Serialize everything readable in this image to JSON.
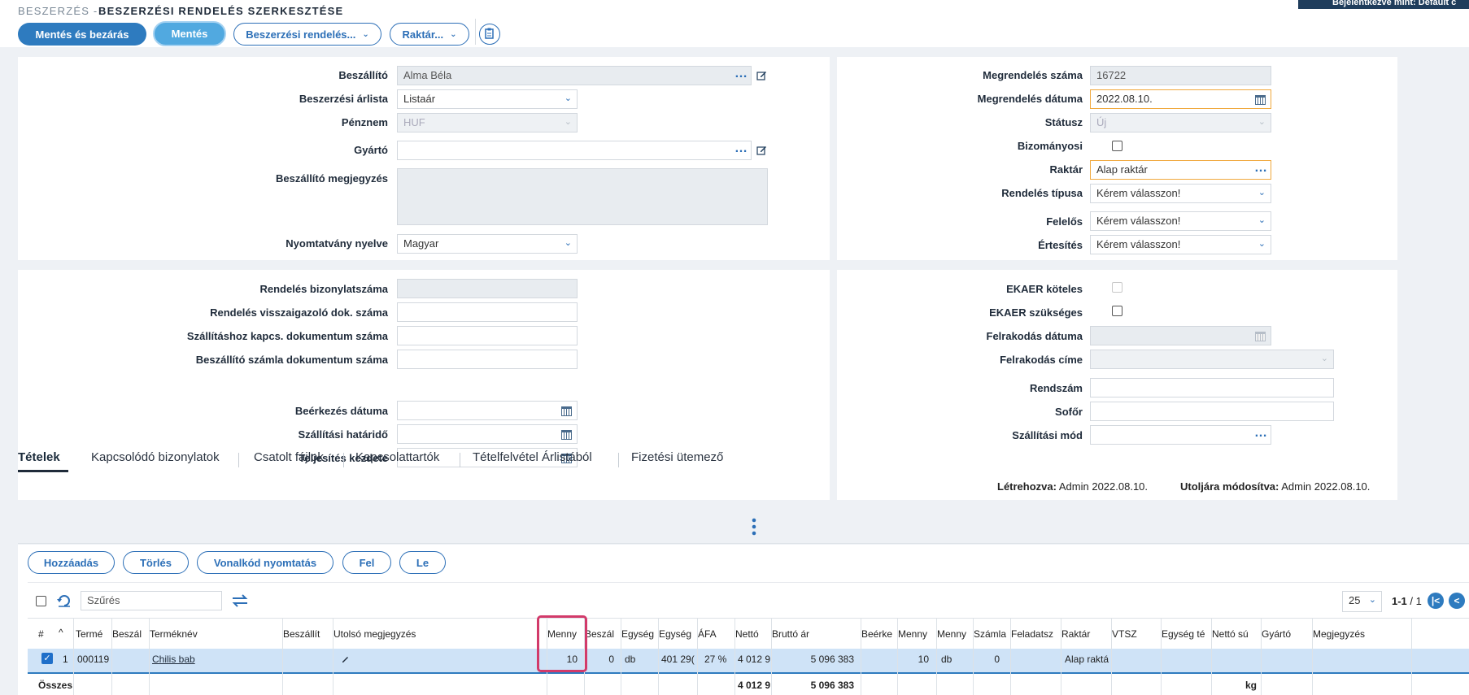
{
  "header": {
    "crumb": "BESZERZÉS -",
    "title": "BESZERZÉSI RENDELÉS SZERKESZTÉSE",
    "login": "Bejelentkezve mint: Default c"
  },
  "toolbar": {
    "save_close": "Mentés és bezárás",
    "save": "Mentés",
    "order_menu": "Beszerzési rendelés...",
    "warehouse_menu": "Raktár..."
  },
  "form1": {
    "supplier_label": "Beszállító",
    "supplier_value": "Alma Béla",
    "pricelist_label": "Beszerzési árlista",
    "pricelist_value": "Listaár",
    "currency_label": "Pénznem",
    "currency_value": "HUF",
    "manufacturer_label": "Gyártó",
    "manufacturer_value": "",
    "note_label": "Beszállító megjegyzés",
    "printlang_label": "Nyomtatvány nyelve",
    "printlang_value": "Magyar"
  },
  "form2": {
    "ordernum_label": "Megrendelés száma",
    "ordernum_value": "16722",
    "orderdate_label": "Megrendelés dátuma",
    "orderdate_value": "2022.08.10.",
    "status_label": "Státusz",
    "status_value": "Új",
    "consign_label": "Bizományosi",
    "warehouse_label": "Raktár",
    "warehouse_value": "Alap raktár",
    "ordertype_label": "Rendelés típusa",
    "ordertype_value": "Kérem válasszon!",
    "responsible_label": "Felelős",
    "responsible_value": "Kérem válasszon!",
    "notify_label": "Értesítés",
    "notify_value": "Kérem válasszon!"
  },
  "form3": {
    "docnum_label": "Rendelés bizonylatszáma",
    "confirm_label": "Rendelés visszaigazoló dok. száma",
    "shipdoc_label": "Szállításhoz kapcs. dokumentum száma",
    "invoice_label": "Beszállító számla dokumentum száma",
    "arrival_label": "Beérkezés dátuma",
    "deadline_label": "Szállítási határidő",
    "fulfil_label": "Teljesítés kezdete"
  },
  "form4": {
    "ekaer_req_label": "EKAER köteles",
    "ekaer_need_label": "EKAER szükséges",
    "loaddate_label": "Felrakodás dátuma",
    "loadaddr_label": "Felrakodás címe",
    "plate_label": "Rendszám",
    "driver_label": "Sofőr",
    "shipmode_label": "Szállítási mód",
    "created_label": "Létrehozva:",
    "created_value": "Admin 2022.08.10.",
    "modified_label": "Utoljára módosítva:",
    "modified_value": "Admin 2022.08.10."
  },
  "tabs": [
    "Tételek",
    "Kapcsolódó bizonylatok",
    "Csatolt fájlok",
    "Kapcsolattartók",
    "Tételfelvétel Árlistából",
    "Fizetési ütemező"
  ],
  "items_toolbar": {
    "add": "Hozzáadás",
    "delete": "Törlés",
    "barcode": "Vonalkód nyomtatás",
    "up": "Fel",
    "down": "Le"
  },
  "grid": {
    "filter_placeholder": "Szűrés",
    "page_size": "25",
    "page_info": "1-1",
    "page_total": "/ 1",
    "columns": [
      "#",
      "Termé",
      "Beszál",
      "Terméknév",
      "Beszállít",
      "Utolsó megjegyzés",
      "Menny",
      "Beszál",
      "Egység",
      "Egység",
      "ÁFA",
      "Nettó",
      "Bruttó ár",
      "Beérke",
      "Menny",
      "Menny",
      "Számla",
      "Feladatsz",
      "Raktár",
      "VTSZ",
      "Egység té",
      "Nettó sú",
      "Gyártó",
      "Megjegyzés"
    ],
    "row": {
      "num": "1",
      "code": "000119",
      "name": "Chilis bab",
      "qty": "10",
      "supp": "0",
      "unit": "db",
      "unitprice": "401 29(",
      "vat": "27 %",
      "net": "4 012 9",
      "gross": "5 096 383",
      "qty2": "10",
      "unit2": "db",
      "inv": "0",
      "warehouse": "Alap raktá"
    },
    "total": {
      "label": "Összes",
      "net": "4 012 9",
      "gross": "5 096 383",
      "weight_unit": "kg"
    }
  },
  "colors": {
    "accent": "#2e7bbf",
    "highlight": "#d23a6a",
    "selected_row": "#cfe3f7"
  }
}
